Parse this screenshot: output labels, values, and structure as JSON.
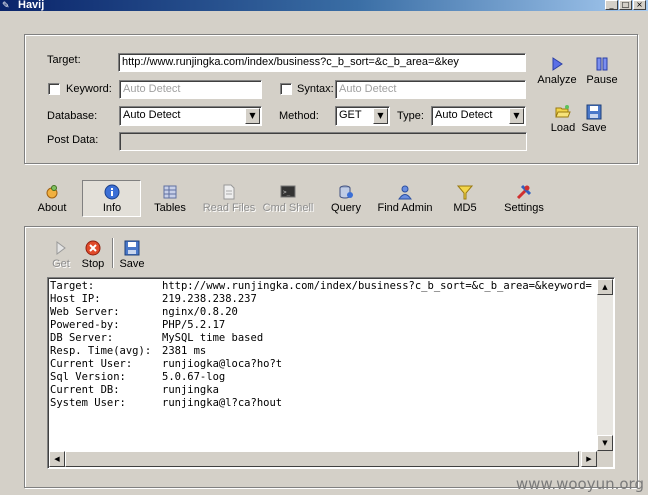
{
  "window": {
    "title": "Havij",
    "min_glyph": "_",
    "max_glyph": "□",
    "close_glyph": "×"
  },
  "form": {
    "target_label": "Target:",
    "target_value": "http://www.runjingka.com/index/business?c_b_sort=&c_b_area=&key",
    "keyword_label": "Keyword:",
    "keyword_value": "Auto Detect",
    "syntax_label": "Syntax:",
    "syntax_value": "Auto Detect",
    "database_label": "Database:",
    "database_value": "Auto Detect",
    "method_label": "Method:",
    "method_value": "GET",
    "type_label": "Type:",
    "type_value": "Auto Detect",
    "post_label": "Post Data:",
    "post_value": ""
  },
  "actions": {
    "analyze": "Analyze",
    "pause": "Pause",
    "load": "Load",
    "save": "Save"
  },
  "tabs": [
    {
      "label": "About",
      "icon": "about-icon"
    },
    {
      "label": "Info",
      "icon": "info-icon"
    },
    {
      "label": "Tables",
      "icon": "tables-icon"
    },
    {
      "label": "Read Files",
      "icon": "read-files-icon"
    },
    {
      "label": "Cmd Shell",
      "icon": "cmd-shell-icon"
    },
    {
      "label": "Query",
      "icon": "query-icon"
    },
    {
      "label": "Find Admin",
      "icon": "find-admin-icon"
    },
    {
      "label": "MD5",
      "icon": "md5-icon"
    },
    {
      "label": "Settings",
      "icon": "settings-icon"
    }
  ],
  "active_tab": "Info",
  "subtoolbar": {
    "get": "Get",
    "stop": "Stop",
    "save": "Save"
  },
  "output": [
    {
      "key": "Target:",
      "value": "http://www.runjingka.com/index/business?c_b_sort=&c_b_area=&keyword="
    },
    {
      "key": "Host IP:",
      "value": "219.238.238.237"
    },
    {
      "key": "Web Server:",
      "value": "nginx/0.8.20"
    },
    {
      "key": "Powered-by:",
      "value": "PHP/5.2.17"
    },
    {
      "key": "DB Server:",
      "value": "MySQL time based"
    },
    {
      "key": "Resp. Time(avg):",
      "value": "2381 ms"
    },
    {
      "key": "Current User:",
      "value": "runjiogka@loca?ho?t"
    },
    {
      "key": "Sql Version:",
      "value": "5.0.67-log"
    },
    {
      "key": "Current DB:",
      "value": "runjingka"
    },
    {
      "key": "System User:",
      "value": "runjingka@l?ca?hout"
    }
  ],
  "watermark": "www.wooyun.org"
}
